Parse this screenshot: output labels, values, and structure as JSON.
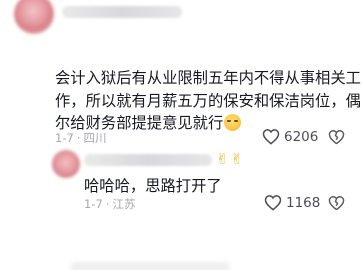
{
  "comments": [
    {
      "lines": [
        "会计入狱后有从业限制五年内不得从事相关工",
        "作，所以就有月薪五万的保安和保洁岗位，偶",
        "尔给财务部提提意见就行"
      ],
      "trailing_emoji": "sweat-smile-emoji",
      "date": "1-7",
      "location": "四川",
      "likes": "6206"
    },
    {
      "emoji": "✌✌",
      "lines": [
        "哈哈哈，思路打开了"
      ],
      "date": "1-7",
      "location": "江苏",
      "likes": "1168"
    }
  ],
  "colors": {
    "text": "#161823",
    "meta": "#a8a8ad",
    "like_count": "#4d4e55"
  }
}
